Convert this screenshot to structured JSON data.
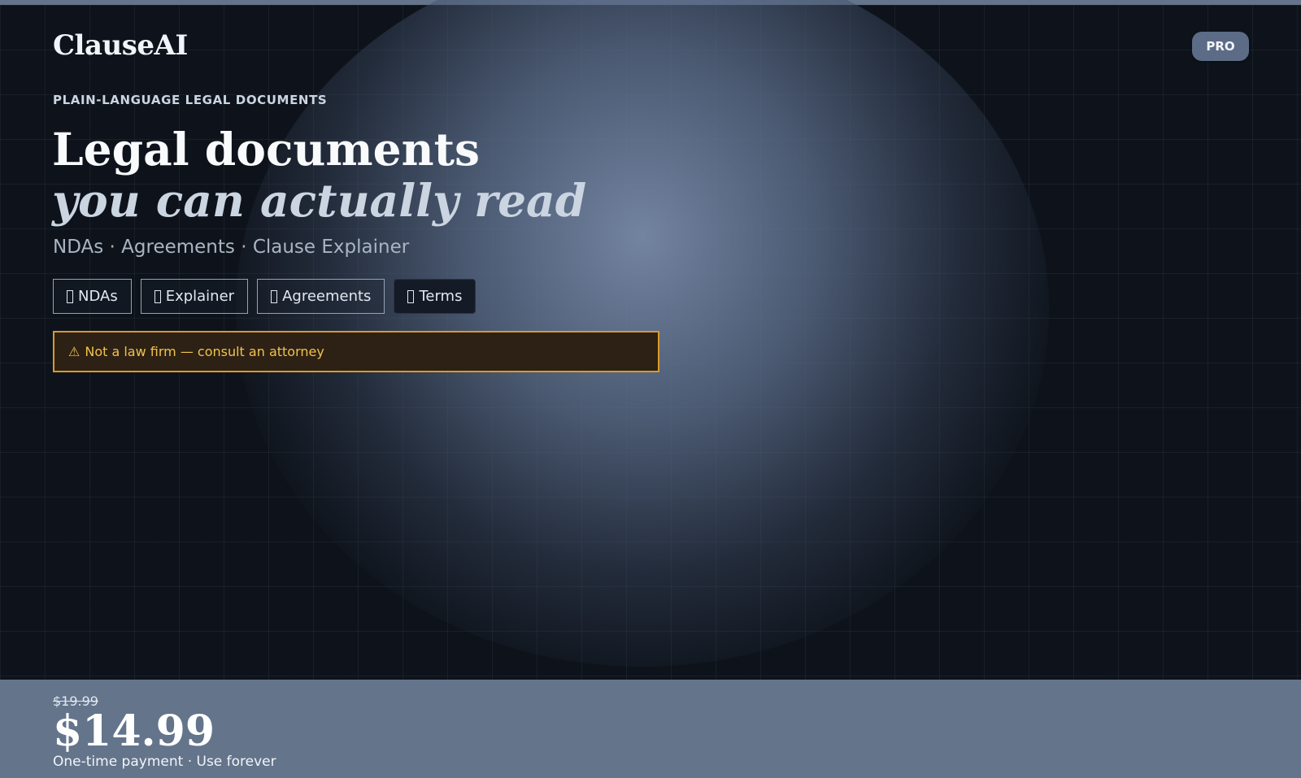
{
  "header": {
    "brand": "ClauseAI",
    "badge": "PRO"
  },
  "hero": {
    "eyebrow": "PLAIN-LANGUAGE LEGAL DOCUMENTS",
    "title_line1": "Legal documents",
    "title_line2": "you can actually read",
    "subtitle": "NDAs · Agreements · Clause Explainer"
  },
  "tabs": [
    {
      "label": "NDAs",
      "icon": "document-icon"
    },
    {
      "label": "Explainer",
      "icon": "document-icon"
    },
    {
      "label": "Agreements",
      "icon": "document-icon"
    },
    {
      "label": "Terms",
      "icon": "document-icon",
      "active": true
    }
  ],
  "disclaimer": {
    "icon": "warning-icon",
    "glyph": "⚠",
    "text": "Not a law firm — consult an attorney"
  },
  "pricing": {
    "original_price": "$19.99",
    "price": "$14.99",
    "note": "One-time payment · Use forever"
  },
  "colors": {
    "background": "#0e131b",
    "accent": "#64748b",
    "warning_border": "#d99a2b",
    "warning_text": "#f2c14e"
  }
}
